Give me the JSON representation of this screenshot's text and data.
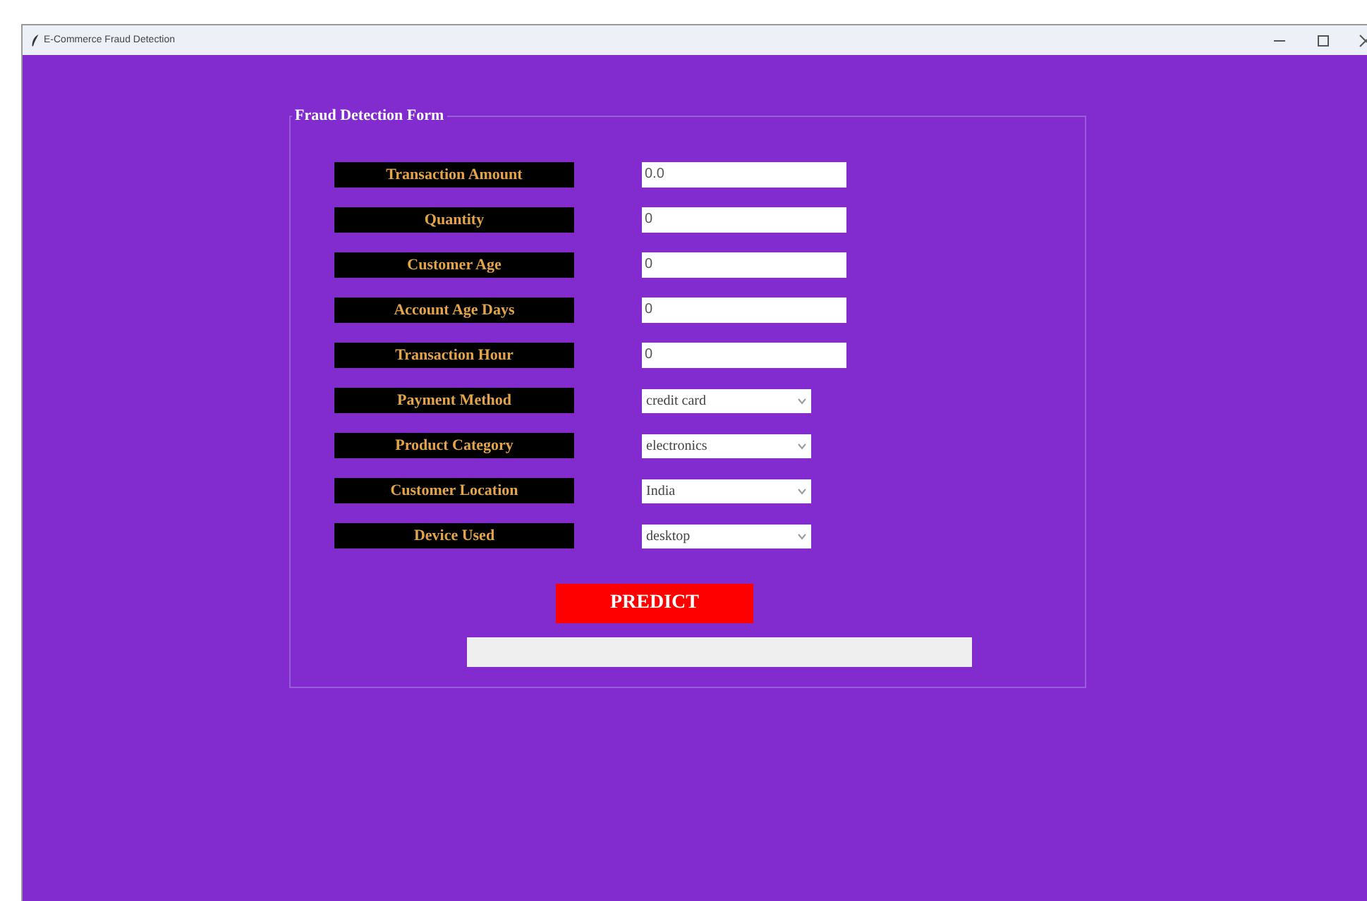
{
  "window": {
    "title": "E-Commerce Fraud Detection"
  },
  "form": {
    "title": "Fraud Detection Form",
    "fields": [
      {
        "label": "Transaction Amount",
        "kind": "entry",
        "value": "0.0"
      },
      {
        "label": "Quantity",
        "kind": "entry",
        "value": "0"
      },
      {
        "label": "Customer Age",
        "kind": "entry",
        "value": "0"
      },
      {
        "label": "Account Age Days",
        "kind": "entry",
        "value": "0"
      },
      {
        "label": "Transaction Hour",
        "kind": "entry",
        "value": "0"
      },
      {
        "label": "Payment Method",
        "kind": "combo",
        "value": "credit card"
      },
      {
        "label": "Product Category",
        "kind": "combo",
        "value": "electronics"
      },
      {
        "label": "Customer Location",
        "kind": "combo",
        "value": "India"
      },
      {
        "label": "Device Used",
        "kind": "combo",
        "value": "desktop"
      }
    ],
    "button": "PREDICT"
  }
}
